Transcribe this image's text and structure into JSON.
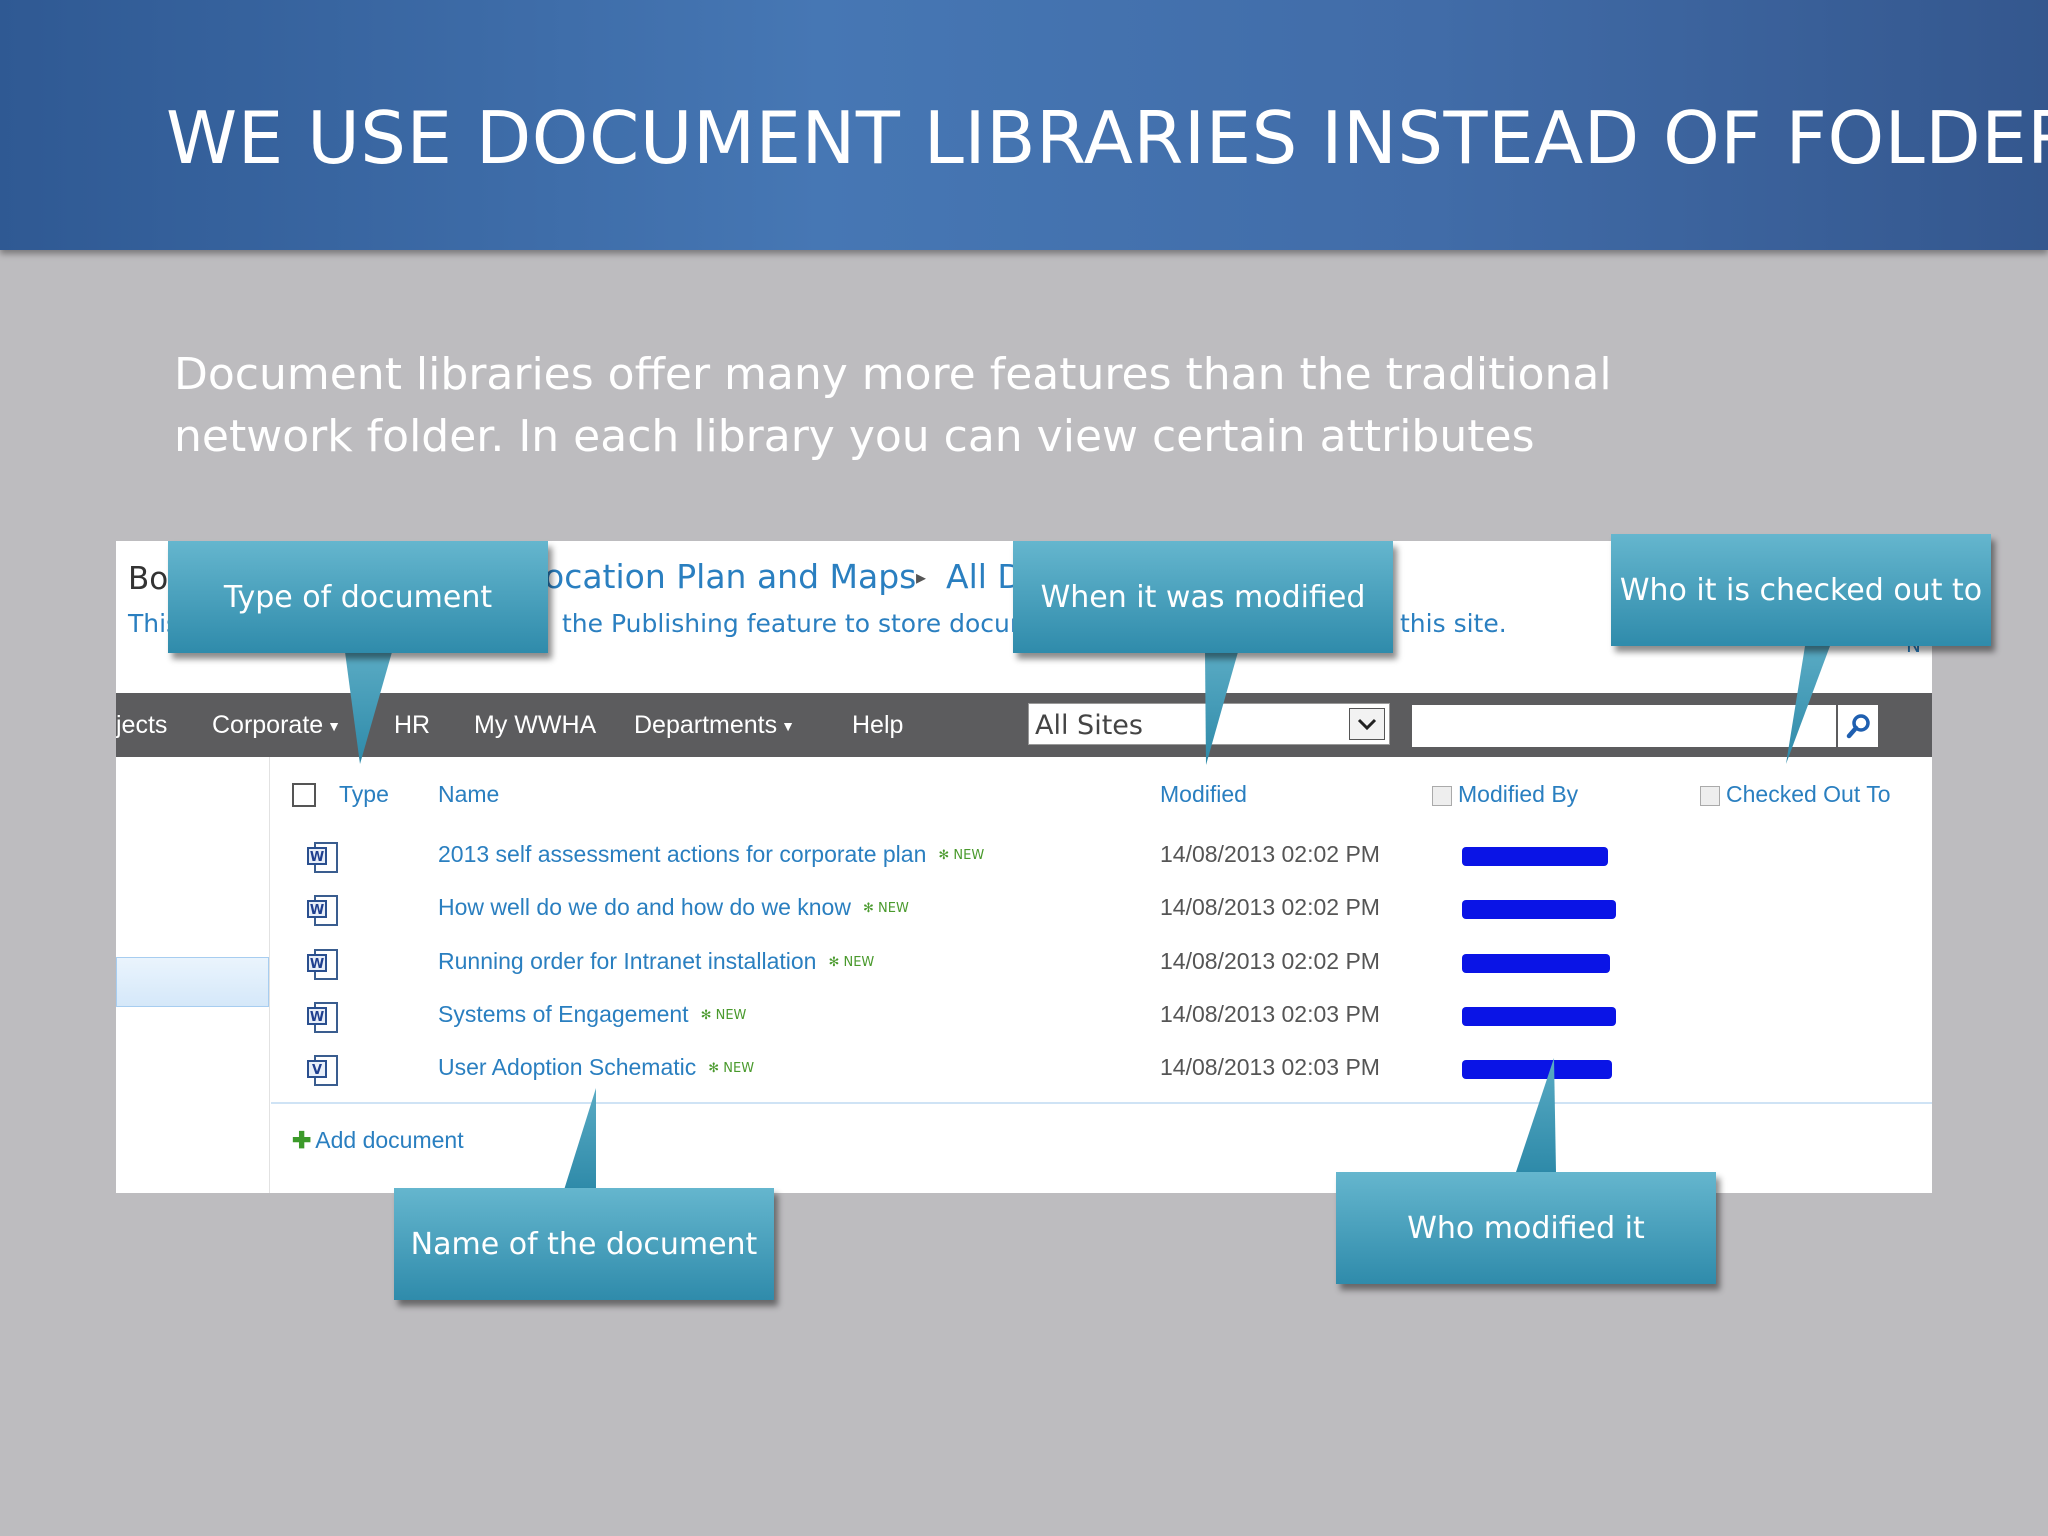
{
  "slide": {
    "title": "WE USE DOCUMENT LIBRARIES INSTEAD OF FOLDERS",
    "body": "Document libraries offer many more features than the traditional network folder. In each library you can view certain attributes"
  },
  "screenshot": {
    "breadcrumb": {
      "prefix": "Bo",
      "library": "ocation Plan and Maps",
      "separator": "▸",
      "view": "All D"
    },
    "description": {
      "part_a": "This",
      "part_b": "the Publishing feature to store docum",
      "part_c": "this site.",
      "part_d": "N"
    },
    "nav": {
      "items": [
        "jects",
        "Corporate",
        "HR",
        "My WWHA",
        "Departments",
        "Help"
      ],
      "search_scope": "All Sites",
      "search_placeholder": ""
    },
    "columns": {
      "type": "Type",
      "name": "Name",
      "modified": "Modified",
      "modified_by": "Modified By",
      "checked_out_to": "Checked Out To"
    },
    "documents": [
      {
        "name": "2013 self assessment actions for corporate plan",
        "badge": "NEW",
        "modified": "14/08/2013 02:02 PM",
        "icon": "word-document-icon"
      },
      {
        "name": "How well do we do and how do we know",
        "badge": "NEW",
        "modified": "14/08/2013 02:02 PM",
        "icon": "word-document-icon"
      },
      {
        "name": "Running order for Intranet installation",
        "badge": "NEW",
        "modified": "14/08/2013 02:02 PM",
        "icon": "word-document-icon"
      },
      {
        "name": "Systems of Engagement",
        "badge": "NEW",
        "modified": "14/08/2013 02:03 PM",
        "icon": "word-document-icon"
      },
      {
        "name": "User Adoption Schematic",
        "badge": "NEW",
        "modified": "14/08/2013 02:03 PM",
        "icon": "visio-document-icon"
      }
    ],
    "add_document": "Add document"
  },
  "callouts": {
    "type": "Type of document",
    "modified": "When it was modified",
    "checked_out": "Who it is checked out to",
    "name": "Name of the document",
    "modified_by": "Who modified it"
  },
  "colors": {
    "header": "#3f6ea9",
    "callout": "#3d9ab8",
    "link": "#2a7fc0",
    "redaction": "#0a14e6",
    "slide_bg": "#bdbcbf"
  }
}
